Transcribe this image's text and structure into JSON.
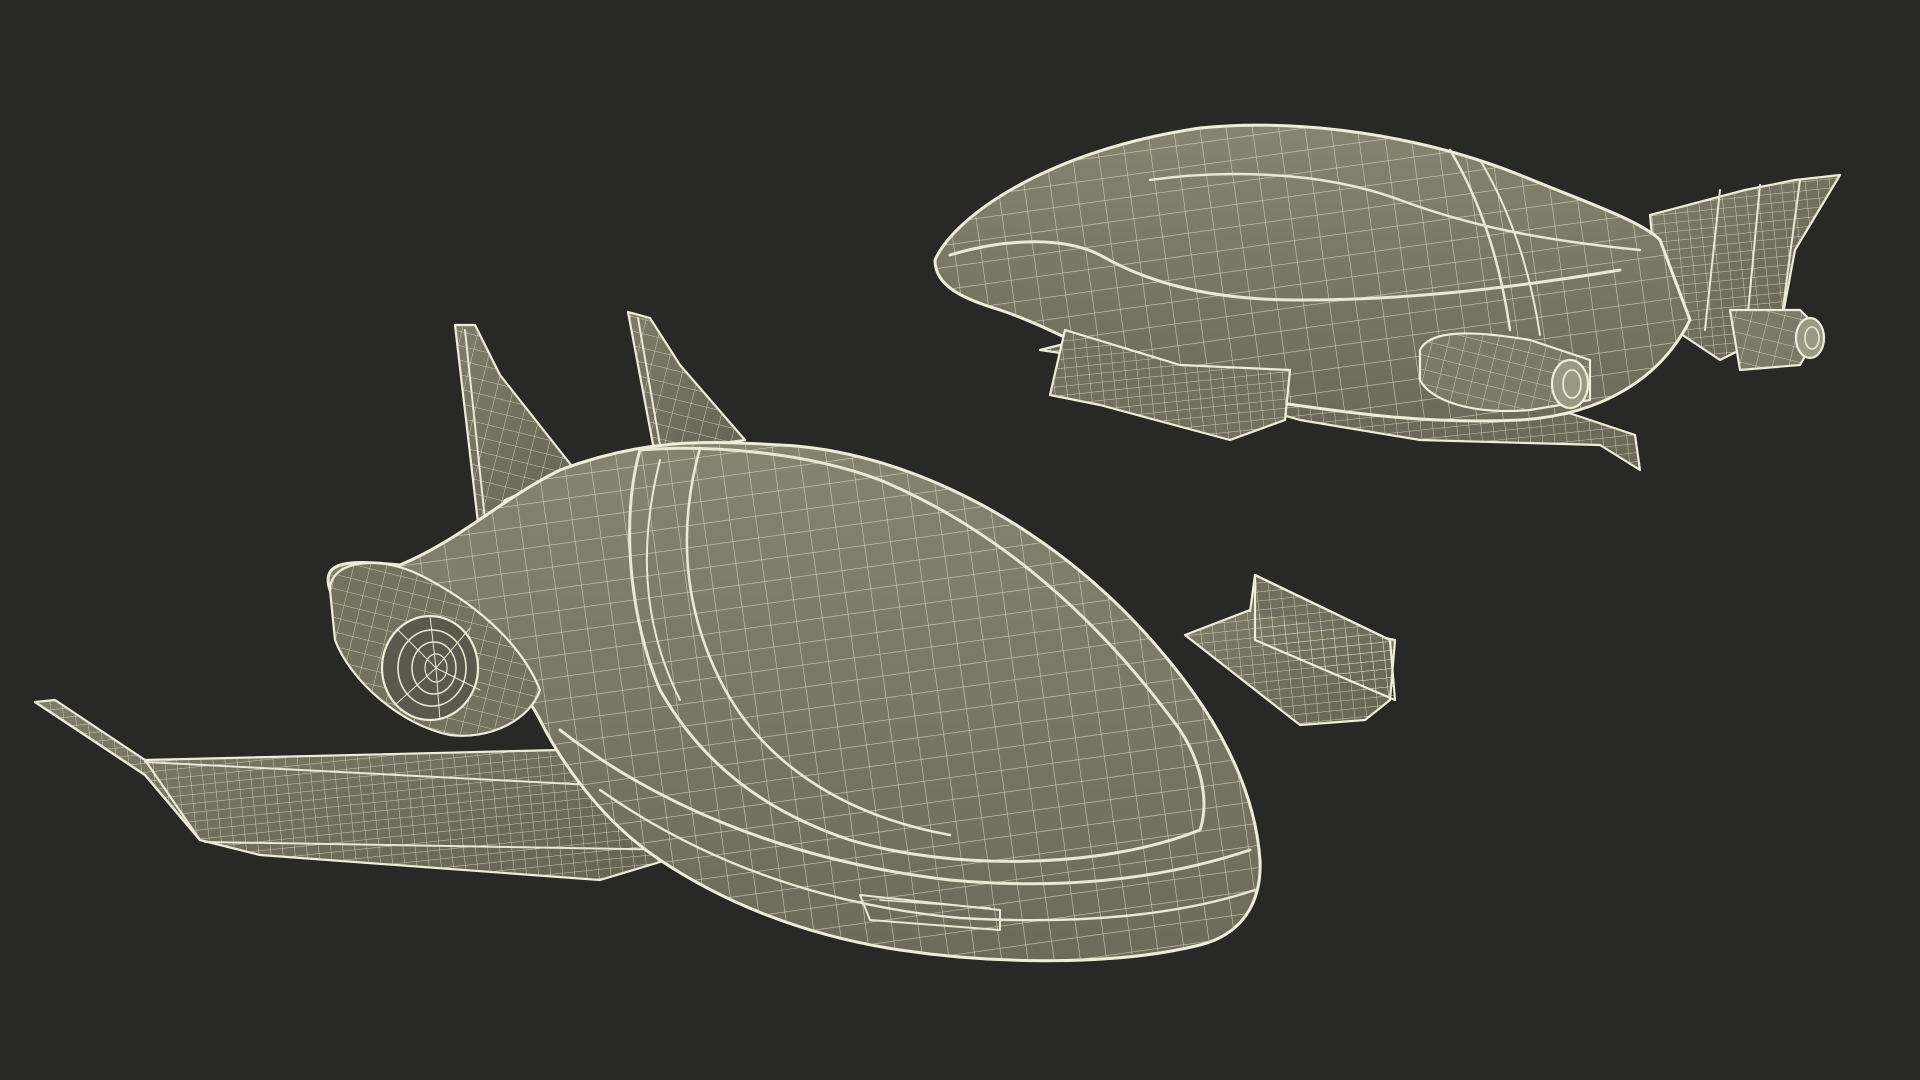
{
  "scene": {
    "background_color": "#282826",
    "wireframe_color": "#e9e8d2",
    "surface_color": "#7b7a68",
    "surface_shadow_color": "#5e5d50",
    "objects": [
      {
        "name": "spaceship-front-left"
      },
      {
        "name": "spaceship-back-right"
      }
    ]
  }
}
